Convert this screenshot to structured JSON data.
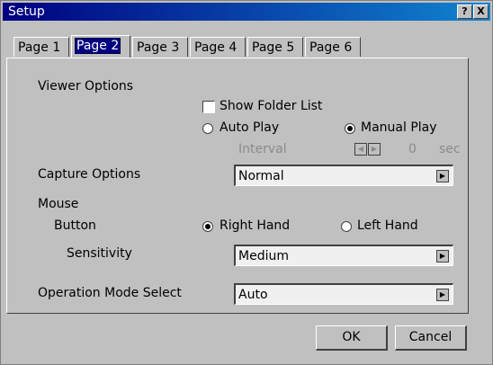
{
  "window": {
    "title": "Setup",
    "help_button": "?",
    "close_button": "X"
  },
  "tabs": [
    {
      "label": "Page 1",
      "active": false
    },
    {
      "label": "Page 2",
      "active": true
    },
    {
      "label": "Page 3",
      "active": false
    },
    {
      "label": "Page 4",
      "active": false
    },
    {
      "label": "Page 5",
      "active": false
    },
    {
      "label": "Page 6",
      "active": false
    }
  ],
  "viewer": {
    "section_label": "Viewer Options",
    "show_folder_list": {
      "label": "Show Folder List",
      "checked": false
    },
    "auto_play": {
      "label": "Auto Play",
      "selected": false
    },
    "manual_play": {
      "label": "Manual Play",
      "selected": true
    },
    "interval": {
      "label": "Interval",
      "value": "0",
      "unit": "sec",
      "enabled": false
    },
    "spin_left": "◀",
    "spin_right": "▶"
  },
  "capture": {
    "label": "Capture Options",
    "value": "Normal"
  },
  "mouse": {
    "label": "Mouse",
    "button_label": "Button",
    "right_hand": {
      "label": "Right Hand",
      "selected": true
    },
    "left_hand": {
      "label": "Left Hand",
      "selected": false
    },
    "sensitivity_label": "Sensitivity",
    "sensitivity_value": "Medium"
  },
  "operation": {
    "label": "Operation Mode Select",
    "value": "Auto"
  },
  "combo_arrow": "▶",
  "buttons": {
    "ok": "OK",
    "cancel": "Cancel"
  },
  "colors": {
    "face": "#c0c0c0",
    "titlebar": "#000080",
    "disabled_text": "#8a8a8a"
  }
}
